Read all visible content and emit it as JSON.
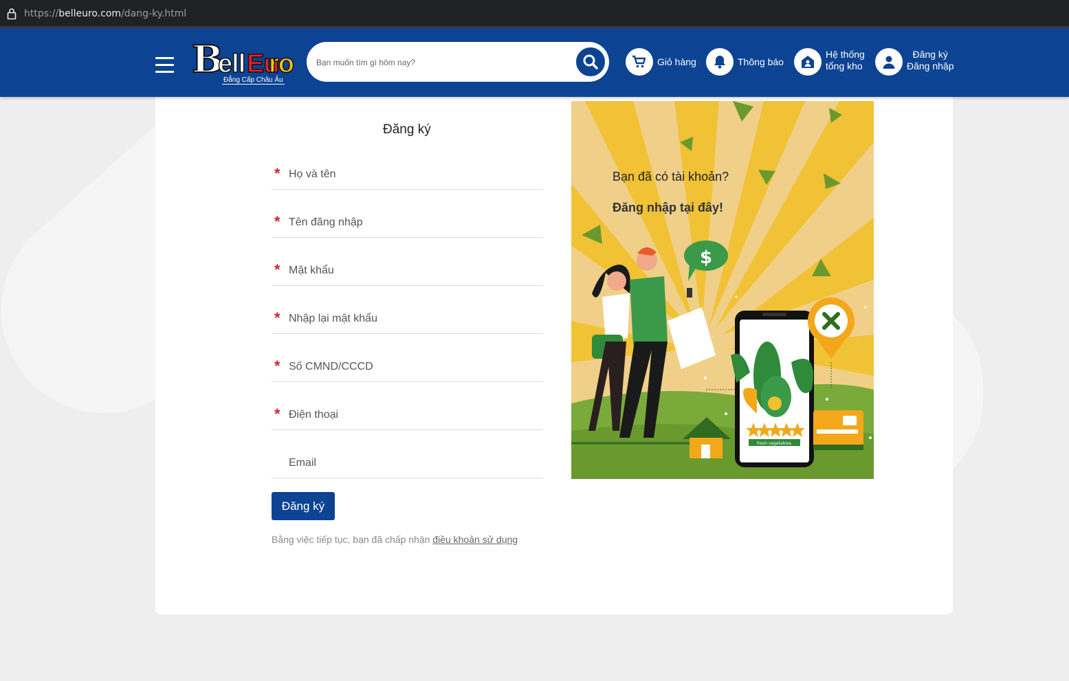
{
  "browser": {
    "url_prefix": "https://",
    "url_host": "belleuro.com",
    "url_path": "/dang-ky.html"
  },
  "header": {
    "logo": {
      "bell": "B",
      "ell": "ell",
      "eu": "Eu",
      "ro": "ro",
      "tagline": "Đẳng Cấp Châu Âu"
    },
    "search_placeholder": "Bạn muốn tìm gì hôm nay?",
    "cart_label": "Giỏ hàng",
    "notify_label": "Thông báo",
    "store_label_1": "Hệ thống",
    "store_label_2": "tổng kho",
    "account_label_1": "Đăng ký",
    "account_label_2": "Đăng nhập"
  },
  "form": {
    "title": "Đăng ký",
    "required_mark": "*",
    "fields": [
      {
        "placeholder": "Họ và tên",
        "required": true
      },
      {
        "placeholder": "Tên đăng nhập",
        "required": true
      },
      {
        "placeholder": "Mật khẩu",
        "required": true
      },
      {
        "placeholder": "Nhập lại mật khẩu",
        "required": true
      },
      {
        "placeholder": "Số CMND/CCCD",
        "required": true
      },
      {
        "placeholder": "Điện thoại",
        "required": true
      },
      {
        "placeholder": "Email",
        "required": false
      }
    ],
    "submit_label": "Đăng ký",
    "terms_text": "Bằng việc tiếp tục, bạn đã chấp nhận ",
    "terms_link": "điều khoản sử dụng"
  },
  "promo": {
    "question": "Bạn đã có tài khoản?",
    "login_link": "Đăng nhập tại đây!",
    "phone_caption": "fresh vegetables",
    "dollar": "$"
  },
  "colors": {
    "brand_blue": "#0c4393",
    "required_red": "#d0262c",
    "illus_bg": "#f2c94c",
    "illus_green": "#6aa33a"
  }
}
